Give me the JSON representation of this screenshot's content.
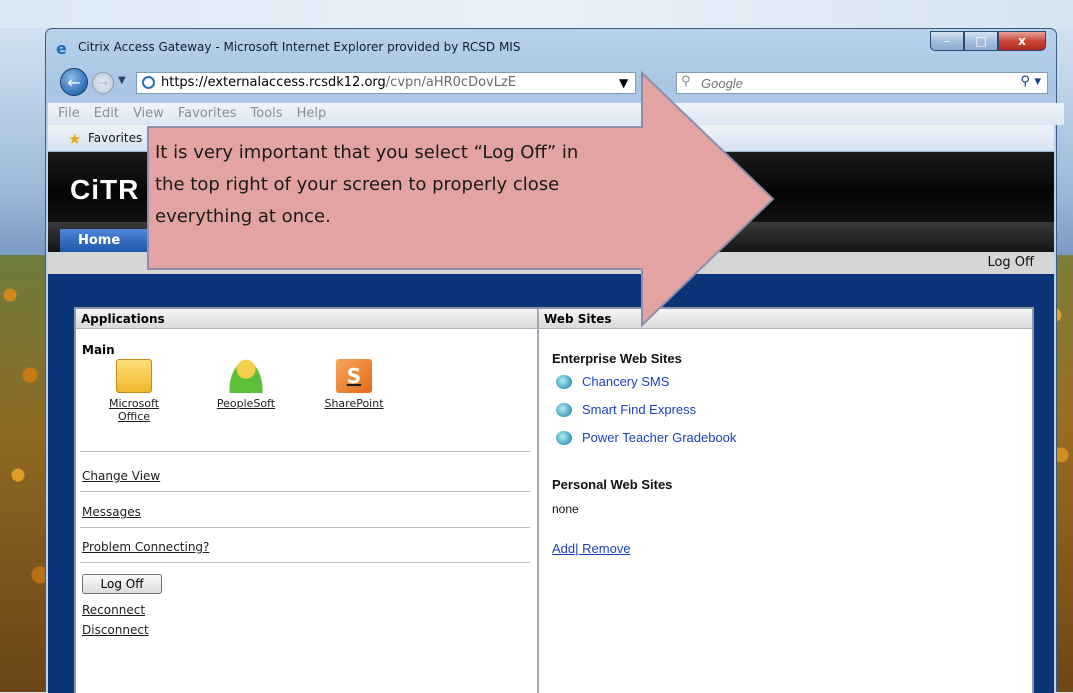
{
  "window": {
    "title": "Citrix Access Gateway - Microsoft Internet Explorer provided by RCSD MIS",
    "buttons": {
      "minimize": "–",
      "maximize": "□",
      "close": "x"
    }
  },
  "address_bar": {
    "url_host": "https://externalaccess.rcsdk12.org",
    "url_path": "/cvpn/aHR0cDovLzE",
    "search_placeholder": "Google"
  },
  "menu": {
    "items": [
      "File",
      "Edit",
      "View",
      "Favorites",
      "Tools",
      "Help"
    ]
  },
  "favorites_bar": {
    "label": "Favorites"
  },
  "citrix": {
    "logo": "CiTR",
    "home_tab": "Home",
    "top_logoff": "Log Off"
  },
  "applications": {
    "header": "Applications",
    "group": "Main",
    "apps": [
      {
        "line1": "Microsoft",
        "line2": "Office",
        "icon": "folder-icon"
      },
      {
        "line1": "PeopleSoft",
        "icon": "peoplesoft-icon"
      },
      {
        "line1": "SharePoint",
        "icon": "sharepoint-icon",
        "glyph": "S"
      }
    ],
    "links": {
      "change_view": "Change View",
      "messages": "Messages",
      "problem": "Problem Connecting?",
      "logoff_button": "Log Off",
      "reconnect": "Reconnect",
      "disconnect": "Disconnect"
    }
  },
  "web_sites": {
    "header": "Web Sites",
    "enterprise_header": "Enterprise Web Sites",
    "enterprise": [
      "Chancery SMS",
      "Smart Find Express",
      "Power Teacher Gradebook"
    ],
    "personal_header": "Personal Web Sites",
    "personal_none": "none",
    "add": "Add",
    "remove": " Remove"
  },
  "annotation": {
    "line1": "It is very important that you select “Log Off” in",
    "line2": "the top right of your screen to properly close",
    "line3": "everything at once.",
    "colors": {
      "fill": "#e4a3a3",
      "stroke": "#8e8eaa"
    }
  }
}
